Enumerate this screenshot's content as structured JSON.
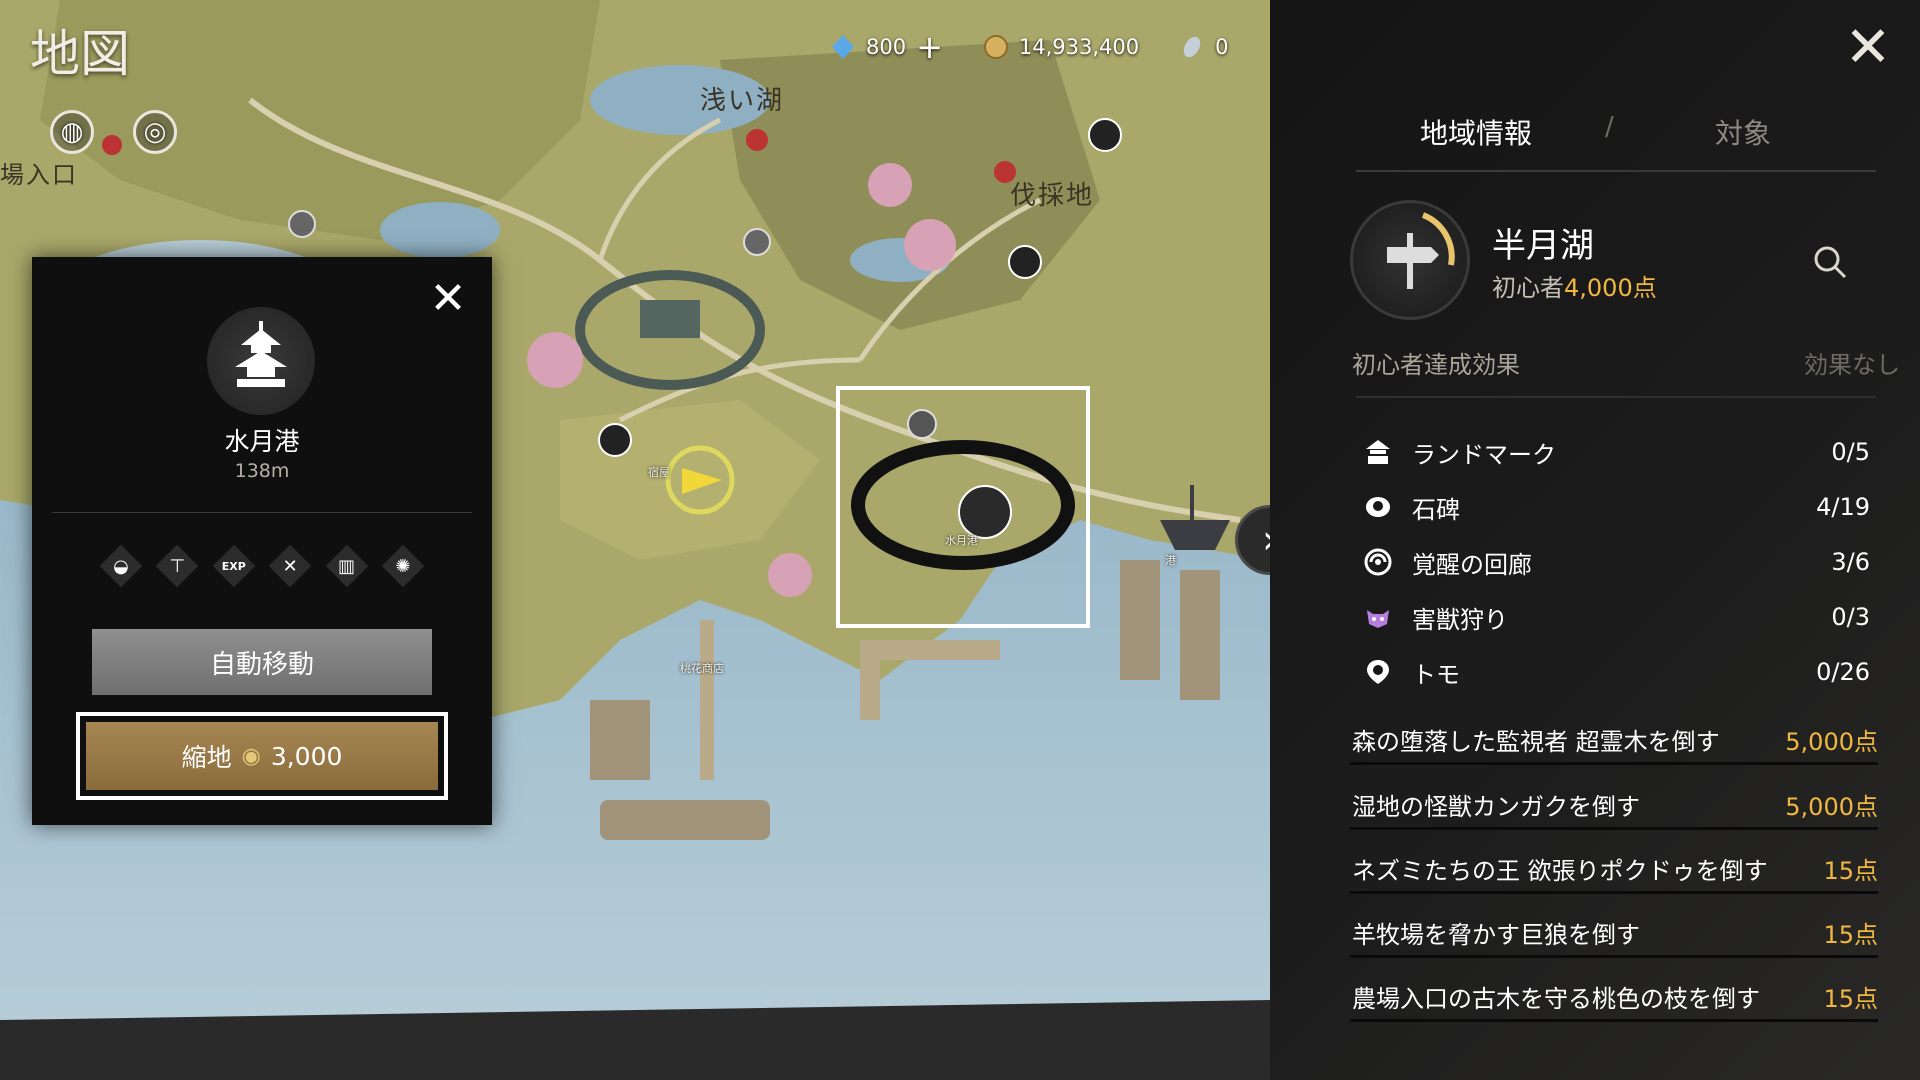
{
  "map": {
    "title": "地図",
    "labels": {
      "lake": "浅い湖",
      "logging": "伐採地",
      "entrance": "場入口",
      "port_small": "水月港",
      "inn": "宿屋",
      "store": "桃花商店",
      "dock": "港"
    },
    "highlight_color": "#ffffff"
  },
  "currency": {
    "diamonds": "800",
    "coins": "14,933,400",
    "feathers": "0"
  },
  "popup": {
    "place_name": "水月港",
    "distance": "138m",
    "facility_icons": [
      "pouch-icon",
      "anvil-icon",
      "exp-icon",
      "tools-icon",
      "storage-icon",
      "lamp-icon"
    ],
    "exp_label": "EXP",
    "auto_move_label": "自動移動",
    "warp_label": "縮地",
    "warp_cost": "3,000"
  },
  "panel": {
    "tabs": {
      "region": "地域情報",
      "target": "対象",
      "slash": "/"
    },
    "region_name": "半月湖",
    "rank_prefix": "初心者",
    "rank_points": "4,000点",
    "achievement_label": "初心者達成効果",
    "achievement_value": "効果なし",
    "categories": [
      {
        "icon": "landmark-icon",
        "label": "ランドマーク",
        "count": "0/5"
      },
      {
        "icon": "stone-tablet-icon",
        "label": "石碑",
        "count": "4/19"
      },
      {
        "icon": "awakening-corridor-icon",
        "label": "覚醒の回廊",
        "count": "3/6"
      },
      {
        "icon": "beast-hunt-icon",
        "label": "害獣狩り",
        "count": "0/3"
      },
      {
        "icon": "tomo-icon",
        "label": "トモ",
        "count": "0/26"
      }
    ],
    "tasks": [
      {
        "label": "森の堕落した監視者 超霊木を倒す",
        "points": "5,000点"
      },
      {
        "label": "湿地の怪獣カンガクを倒す",
        "points": "5,000点"
      },
      {
        "label": "ネズミたちの王 欲張りポクドゥを倒す",
        "points": "15点"
      },
      {
        "label": "羊牧場を脅かす巨狼を倒す",
        "points": "15点"
      },
      {
        "label": "農場入口の古木を守る桃色の枝を倒す",
        "points": "15点"
      }
    ],
    "accent_color": "#f0b840"
  }
}
